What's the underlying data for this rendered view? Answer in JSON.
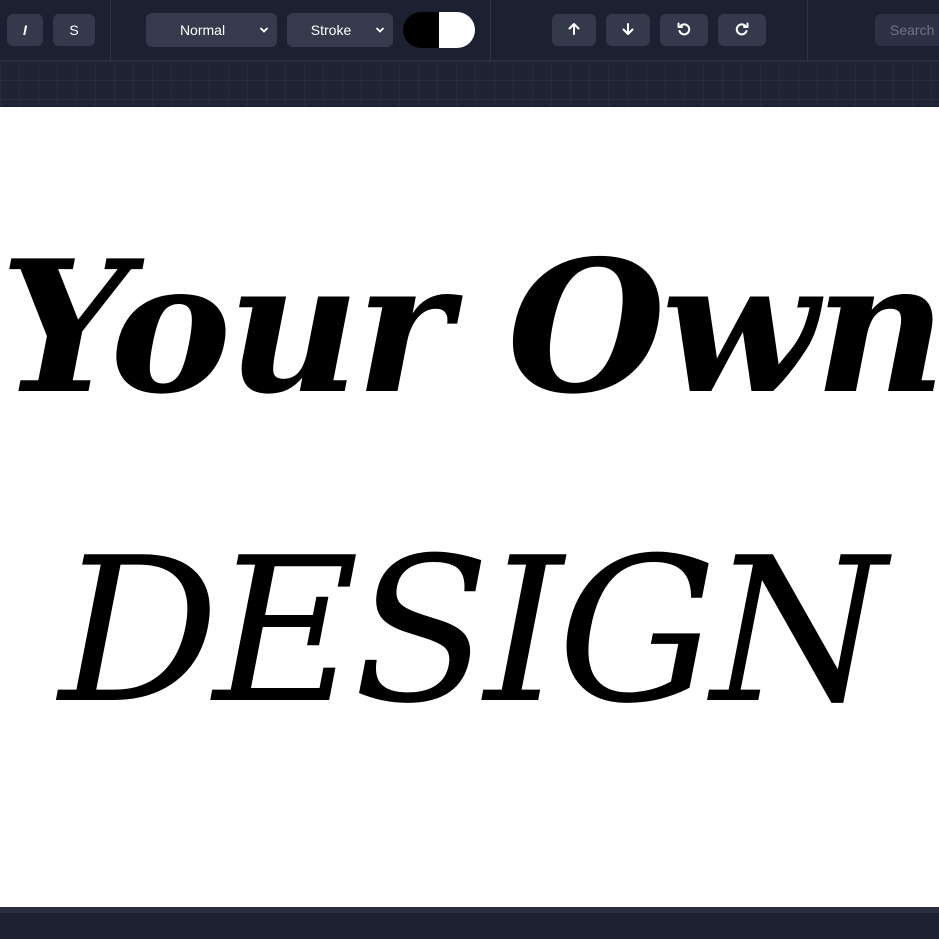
{
  "toolbar": {
    "italic_label": "I",
    "strike_label": "S",
    "blend_mode": {
      "selected": "Normal"
    },
    "paint_mode": {
      "selected": "Stroke"
    },
    "color_toggle": {
      "left_color": "#000000",
      "right_color": "#ffffff"
    },
    "actions": [
      {
        "icon": "arrow-up-icon"
      },
      {
        "icon": "arrow-down-icon"
      },
      {
        "icon": "undo-icon"
      },
      {
        "icon": "redo-icon"
      }
    ],
    "search": {
      "placeholder": "Search"
    }
  },
  "canvas": {
    "background": "#ffffff",
    "text_lines": [
      "Your Own",
      "DESIGN"
    ],
    "text_color": "#000000"
  }
}
